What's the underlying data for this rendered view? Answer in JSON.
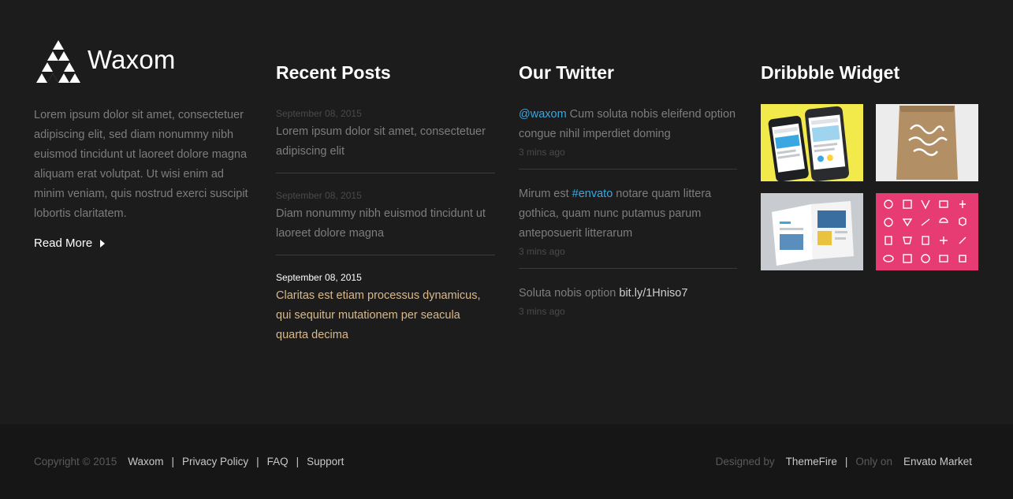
{
  "about": {
    "brand": "Waxom",
    "text": "Lorem ipsum dolor sit amet, consectetuer adipiscing elit, sed diam nonummy nibh euismod tincidunt ut laoreet dolore magna aliquam erat volutpat. Ut wisi enim ad minim veniam, quis nostrud exerci suscipit lobortis claritatem.",
    "read_more": "Read More"
  },
  "recent_posts": {
    "title": "Recent Posts",
    "items": [
      {
        "date": "September 08, 2015",
        "title": "Lorem ipsum dolor sit amet, consectetuer adipiscing elit"
      },
      {
        "date": "September 08, 2015",
        "title": "Diam nonummy nibh euismod tincidunt ut laoreet dolore magna"
      },
      {
        "date": "September 08, 2015",
        "title": "Claritas est etiam processus dynamicus, qui sequitur mutationem per seacula quarta decima"
      }
    ]
  },
  "twitter": {
    "title": "Our Twitter",
    "tweets": [
      {
        "lead": "@waxom",
        "text": " Cum soluta nobis eleifend option congue nihil imperdiet doming",
        "tail": "",
        "time": "3 mins ago"
      },
      {
        "pre": "Mirum est ",
        "lead": "#envato",
        "text": " notare quam littera gothica, quam nunc putamus parum anteposuerit litterarum",
        "time": "3 mins ago"
      },
      {
        "pre": "Soluta nobis option ",
        "link": "bit.ly/1Hniso7",
        "time": "3 mins ago"
      }
    ]
  },
  "dribbble": {
    "title": "Dribbble Widget",
    "shots": [
      "phone-mockup",
      "paper-bag-mockup",
      "magazine-mockup",
      "icon-set"
    ]
  },
  "footer": {
    "copyright": "Copyright © 2015",
    "links": [
      "Waxom",
      "Privacy Policy",
      "FAQ",
      "Support"
    ],
    "designed_by": "Designed by",
    "designer": "ThemeFire",
    "only_on": "Only on",
    "market": "Envato Market"
  },
  "colors": {
    "accent": "#d9b98c",
    "twitter_link": "#3aa7e0",
    "background": "#1c1c1c",
    "footer_bottom": "#161616"
  }
}
